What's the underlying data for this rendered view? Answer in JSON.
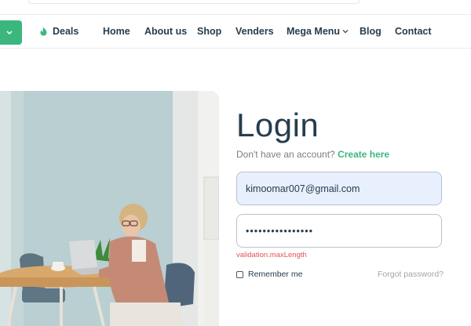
{
  "nav": {
    "deals": "Deals",
    "items": [
      "Home",
      "About us",
      "Shop",
      "Venders",
      "Mega Menu",
      "Blog",
      "Contact"
    ]
  },
  "login": {
    "title": "Login",
    "no_account": "Don't have an account?",
    "create_link": "Create here",
    "email_value": "kimoomar007@gmail.com",
    "password_value": "••••••••••••••••",
    "validation_message": "validation.maxLength",
    "remember_label": "Remember me",
    "forgot_link": "Forgot password?"
  },
  "colors": {
    "brand_green": "#3bb77e",
    "text_dark": "#253d4e",
    "error_red": "#e05353"
  }
}
